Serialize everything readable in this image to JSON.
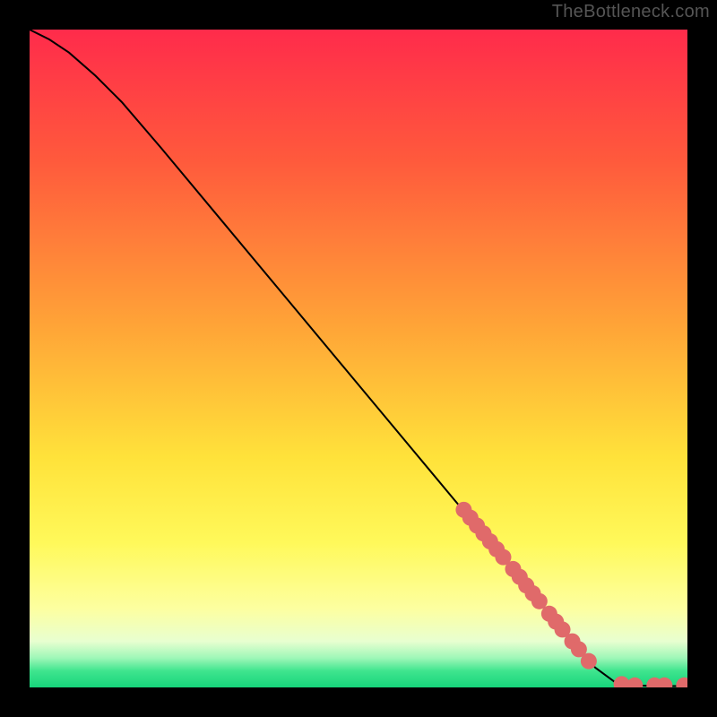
{
  "watermark": "TheBottleneck.com",
  "chart_data": {
    "type": "line",
    "title": "",
    "xlabel": "",
    "ylabel": "",
    "xlim": [
      0,
      100
    ],
    "ylim": [
      0,
      100
    ],
    "gradient_stops": [
      {
        "offset": 0,
        "color": "#ff2b4b"
      },
      {
        "offset": 0.2,
        "color": "#ff5a3c"
      },
      {
        "offset": 0.45,
        "color": "#ffa437"
      },
      {
        "offset": 0.65,
        "color": "#ffe23a"
      },
      {
        "offset": 0.78,
        "color": "#fff95a"
      },
      {
        "offset": 0.88,
        "color": "#fdffa0"
      },
      {
        "offset": 0.93,
        "color": "#e8ffd0"
      },
      {
        "offset": 0.955,
        "color": "#9ff7b8"
      },
      {
        "offset": 0.975,
        "color": "#3fe58e"
      },
      {
        "offset": 1.0,
        "color": "#17d47b"
      }
    ],
    "curve": [
      {
        "x": 0,
        "y": 100
      },
      {
        "x": 3,
        "y": 98.5
      },
      {
        "x": 6,
        "y": 96.5
      },
      {
        "x": 10,
        "y": 93
      },
      {
        "x": 14,
        "y": 89
      },
      {
        "x": 20,
        "y": 82
      },
      {
        "x": 30,
        "y": 70
      },
      {
        "x": 40,
        "y": 58
      },
      {
        "x": 50,
        "y": 46
      },
      {
        "x": 60,
        "y": 34
      },
      {
        "x": 70,
        "y": 22
      },
      {
        "x": 80,
        "y": 10
      },
      {
        "x": 86,
        "y": 3
      },
      {
        "x": 89,
        "y": 0.8
      },
      {
        "x": 92,
        "y": 0.3
      },
      {
        "x": 96,
        "y": 0.2
      },
      {
        "x": 100,
        "y": 0.2
      }
    ],
    "markers": [
      {
        "x": 66,
        "y": 27
      },
      {
        "x": 67,
        "y": 25.8
      },
      {
        "x": 68,
        "y": 24.6
      },
      {
        "x": 69,
        "y": 23.4
      },
      {
        "x": 70,
        "y": 22.2
      },
      {
        "x": 71,
        "y": 21
      },
      {
        "x": 72,
        "y": 19.8
      },
      {
        "x": 73.5,
        "y": 18
      },
      {
        "x": 74.5,
        "y": 16.8
      },
      {
        "x": 75.5,
        "y": 15.5
      },
      {
        "x": 76.5,
        "y": 14.3
      },
      {
        "x": 77.5,
        "y": 13.1
      },
      {
        "x": 79,
        "y": 11.2
      },
      {
        "x": 80,
        "y": 10
      },
      {
        "x": 81,
        "y": 8.8
      },
      {
        "x": 82.5,
        "y": 7
      },
      {
        "x": 83.5,
        "y": 5.8
      },
      {
        "x": 85,
        "y": 4
      },
      {
        "x": 90,
        "y": 0.5
      },
      {
        "x": 92,
        "y": 0.3
      },
      {
        "x": 95,
        "y": 0.3
      },
      {
        "x": 96.5,
        "y": 0.3
      },
      {
        "x": 99.5,
        "y": 0.3
      }
    ],
    "marker_color": "#e06a6a",
    "marker_radius": 9,
    "line_color": "#000000",
    "line_width": 2
  }
}
